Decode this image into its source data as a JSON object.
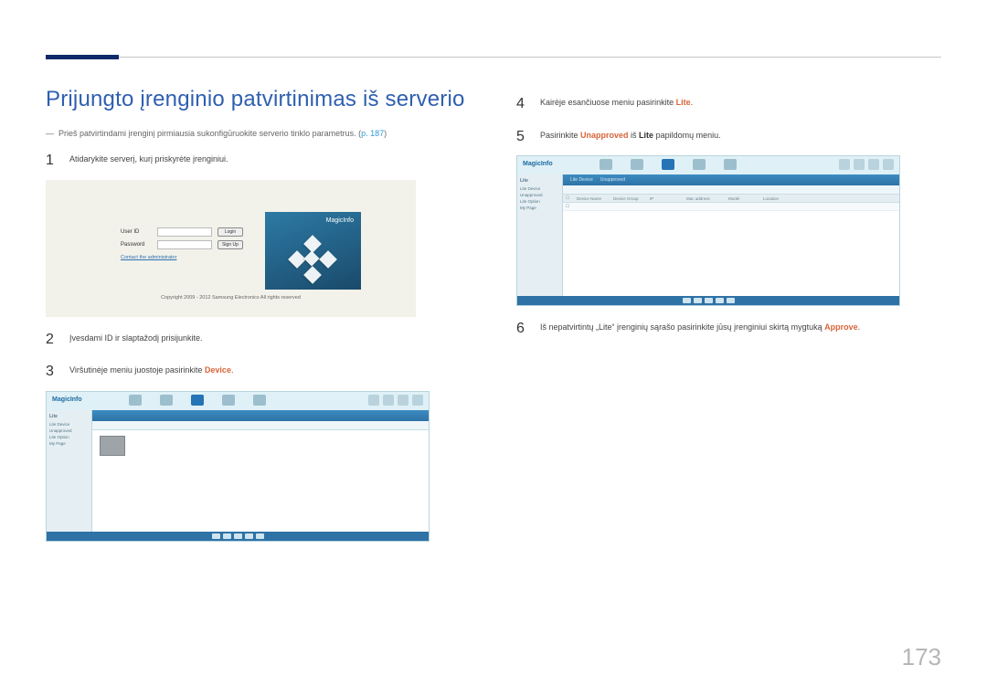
{
  "page_number": "173",
  "left": {
    "title": "Prijungto įrenginio patvirtinimas iš serverio",
    "precondition_prefix": "Prieš patvirtindami įrenginį pirmiausia sukonfigūruokite serverio tinklo parametrus. (",
    "precondition_link": "p. 187",
    "precondition_suffix": ")",
    "step1": "Atidarykite serverį, kurį priskyrėte įrenginiui.",
    "step2": "Įvesdami ID ir slaptažodį prisijunkite.",
    "step3_prefix": "Viršutinėje meniu juostoje pasirinkite ",
    "step3_hl": "Device",
    "step3_suffix": "."
  },
  "right": {
    "step4_prefix": "Kairėje esančiuose meniu pasirinkite ",
    "step4_hl": "Lite",
    "step4_suffix": ".",
    "step5_a": "Pasirinkite ",
    "step5_hl1": "Unapproved",
    "step5_b": " iš ",
    "step5_hl2": "Lite",
    "step5_c": " papildomų meniu.",
    "step6_prefix": "Iš nepatvirtintų „Lite“ įrenginių sąrašo pasirinkite jūsų įrenginiui skirtą mygtuką ",
    "step6_hl": "Approve",
    "step6_suffix": "."
  },
  "login": {
    "user_id": "User ID",
    "password": "Password",
    "login_btn": "Login",
    "signup_btn": "Sign Up",
    "contact": "Contact the administrator",
    "brand": "MagicInfo",
    "copyright": "Copyright 2009 - 2012 Samsung Electronics All rights reserved"
  },
  "app": {
    "brand": "MagicInfo",
    "sidebar_head": "Lite",
    "sb1": "Lite Device",
    "sb2": "Unapproved",
    "sb3": "Lite Option",
    "sb4": "My Page"
  },
  "table": {
    "h_name": "Device Name",
    "h_group": "Device Group",
    "h_ip": "IP",
    "h_mac": "Mac address",
    "h_model": "Model",
    "h_loc": "Location"
  }
}
